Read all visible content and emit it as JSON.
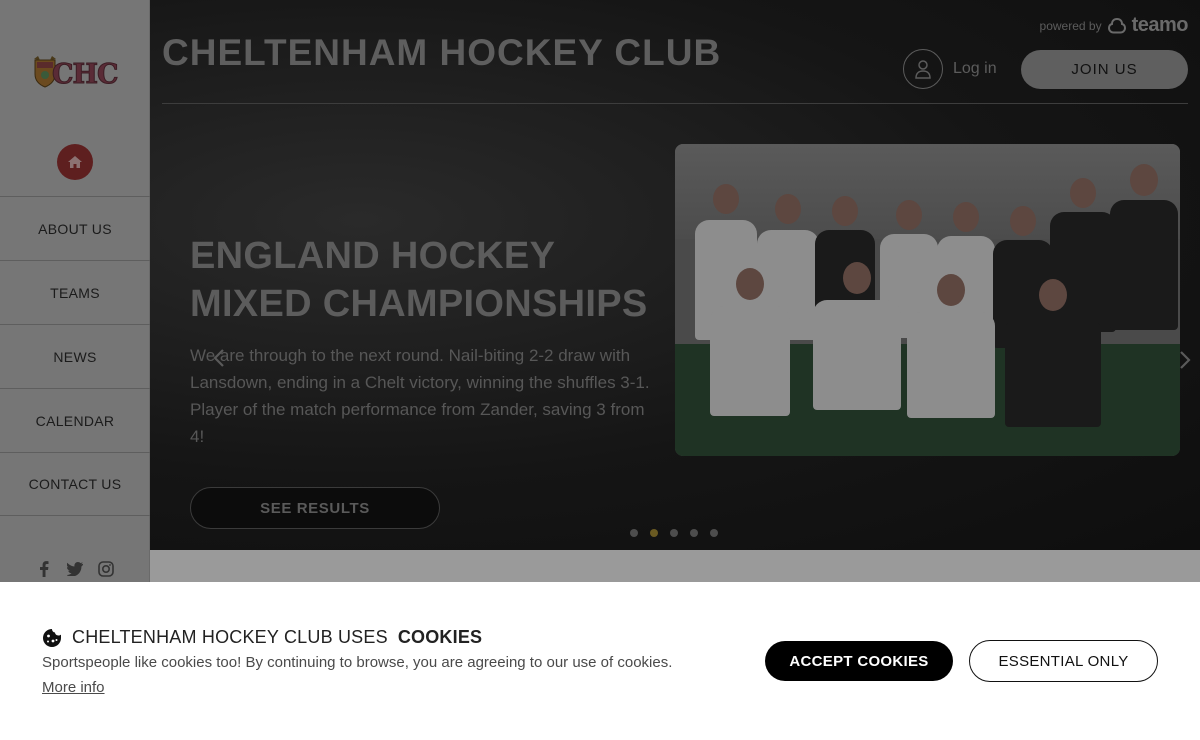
{
  "brand": {
    "logo_text": "CHC",
    "site_title": "CHELTENHAM HOCKEY CLUB",
    "powered_by": "powered by",
    "platform": "teamo"
  },
  "header": {
    "login_label": "Log in",
    "join_label": "JOIN US"
  },
  "sidebar": {
    "items": [
      {
        "label": "ABOUT US"
      },
      {
        "label": "TEAMS"
      },
      {
        "label": "NEWS"
      },
      {
        "label": "CALENDAR"
      },
      {
        "label": "CONTACT US"
      }
    ],
    "socials": [
      "facebook-icon",
      "twitter-icon",
      "instagram-icon"
    ]
  },
  "hero": {
    "headline_line1": "ENGLAND HOCKEY",
    "headline_line2": "MIXED CHAMPIONSHIPS",
    "description": "We are through to the next round. Nail-biting 2-2 draw with Lansdown, ending in a Chelt victory, winning the shuffles 3-1. Player of the match performance from Zander, saving 3 from 4!",
    "cta_label": "SEE RESULTS",
    "slide_count": 5,
    "active_slide": 2
  },
  "cookies": {
    "title_prefix": "CHELTENHAM HOCKEY CLUB USES",
    "title_bold": "COOKIES",
    "message": "Sportspeople like cookies too! By continuing to browse, you are agreeing to our use of cookies.",
    "more_info": "More info",
    "accept_label": "ACCEPT COOKIES",
    "essential_label": "ESSENTIAL ONLY"
  },
  "colors": {
    "accent_red": "#5e1f1f",
    "active_dot": "#6a5a22",
    "overlay": "#141414"
  }
}
